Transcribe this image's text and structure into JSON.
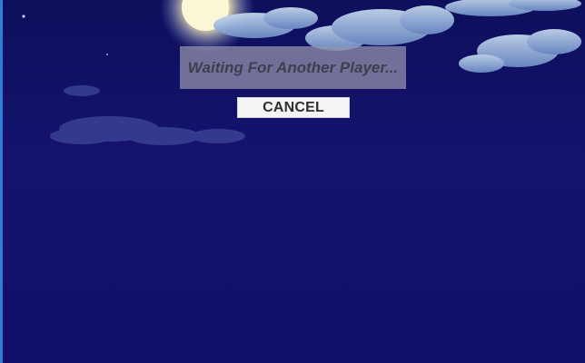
{
  "game": {
    "status_message": "Waiting For Another Player...",
    "cancel_label": "CANCEL"
  },
  "colors": {
    "background": "#13106e",
    "status_box": "#9696af",
    "status_text": "#3f3f4c",
    "button": "#f4f4f6",
    "button_text": "#2e2e2e"
  }
}
